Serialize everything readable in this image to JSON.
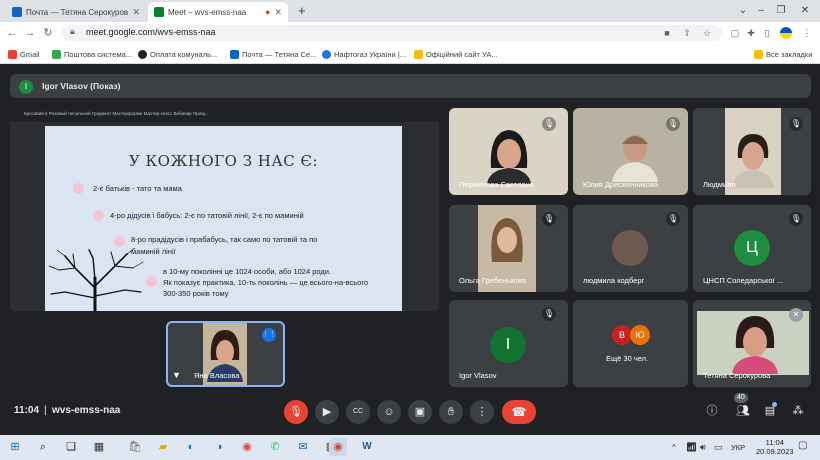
{
  "tabs": [
    {
      "title": "Почта — Тетяна Серокурова —",
      "active": false
    },
    {
      "title": "Meet – wvs-emss-naa",
      "active": true
    }
  ],
  "new_tab": "+",
  "address": {
    "url": "meet.google.com/wvs-emss-naa"
  },
  "bookmarks": [
    {
      "label": "Gmail"
    },
    {
      "label": "Поштова система..."
    },
    {
      "label": "Оплата комуналь..."
    },
    {
      "label": "Почта — Тетяна Се..."
    },
    {
      "label": "Нафтогаз України |..."
    },
    {
      "label": "Офіційний сайт УА..."
    }
  ],
  "all_bookmarks": "Все закладки",
  "presenter": {
    "initial": "I",
    "label": "Igor Vlasov (Показ)"
  },
  "shared_doc_title": "Кросивий в Розовый Чесальной Градиент Мастерформе Мастер-класс Вебинар Призу...",
  "slide": {
    "title": "У КОЖНОГО З НАС Є:",
    "lines": [
      "2-є батьків - тато та мама",
      "4-ро дідусів і бабусь: 2-є по татовій лінії, 2-є по маминій",
      "8-ро прадідусів і прабабусь, так само по татовій та по",
      "маминій лінії",
      "в 10-му поколінні це 1024 особи, або 1024 роди.",
      "Як показує практика, 10-ть поколінь — це всього-на-всього",
      "300-350 років тому"
    ]
  },
  "participants": [
    {
      "name": "Перминова Светлана"
    },
    {
      "name": "Юлия Дресвянникова"
    },
    {
      "name": "Людмила"
    },
    {
      "name": "Ольга Гребенькова"
    },
    {
      "name": "людмила кодберг"
    },
    {
      "name": "ЦНСП Соледарської ...",
      "initial": "Ц",
      "color": "#1e8e3e"
    },
    {
      "name": "Igor Vlasov",
      "initial": "I",
      "color": "#137333"
    },
    {
      "name": "Ещё 30 чел.",
      "initials": [
        "В",
        "Ю"
      ],
      "colors": [
        "#c5221f",
        "#e8710a"
      ]
    },
    {
      "name": "Тетяна Серокурова"
    }
  ],
  "self": {
    "name": "Яна Власова"
  },
  "meeting": {
    "time": "11:04",
    "separator": "|",
    "code": "wvs-emss-naa",
    "people_count": "40"
  },
  "taskbar": {
    "lang": "УКР",
    "time": "11:04",
    "date": "20.09.2023"
  }
}
